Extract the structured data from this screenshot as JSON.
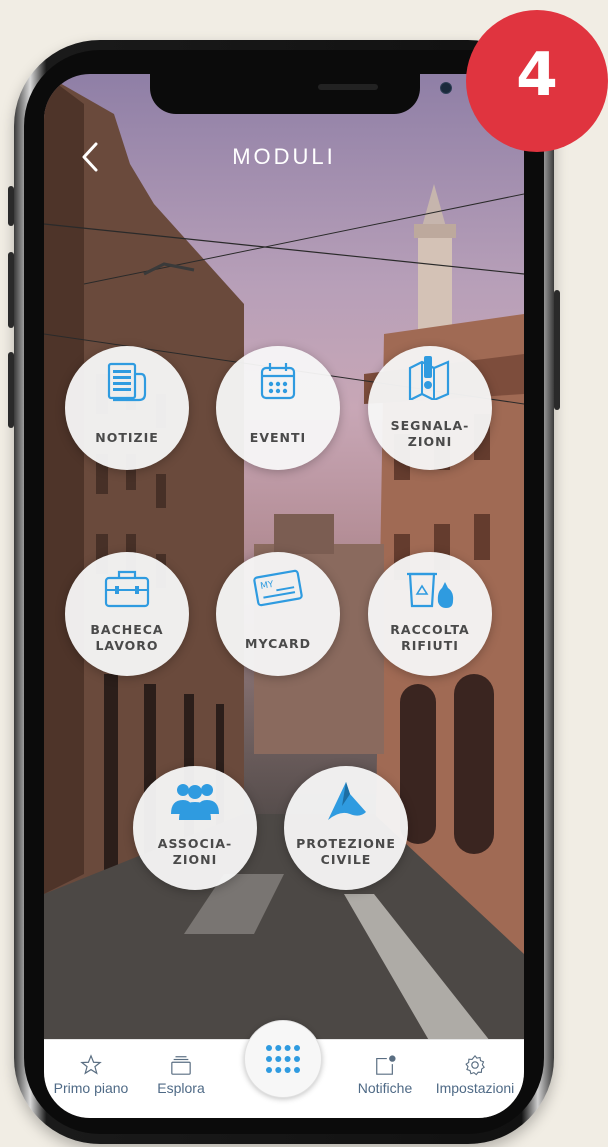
{
  "badge": {
    "number": "4",
    "color": "#e0343f"
  },
  "header": {
    "title": "MODULI",
    "back_icon": "chevron-left-icon"
  },
  "modules": [
    {
      "label": "NOTIZIE",
      "icon": "newspaper-icon"
    },
    {
      "label": "EVENTI",
      "icon": "calendar-icon"
    },
    {
      "label": "SEGNALA-\nZIONI",
      "icon": "map-alert-icon"
    },
    {
      "label": "BACHECA\nLAVORO",
      "icon": "briefcase-icon"
    },
    {
      "label": "MYCARD",
      "icon": "card-icon"
    },
    {
      "label": "RACCOLTA\nRIFIUTI",
      "icon": "recycle-bin-icon"
    },
    {
      "label": "ASSOCIA-\nZIONI",
      "icon": "group-icon"
    },
    {
      "label": "PROTEZIONE\nCIVILE",
      "icon": "civil-protection-icon"
    }
  ],
  "tabbar": {
    "tabs": [
      {
        "label": "Primo piano",
        "icon": "star-icon"
      },
      {
        "label": "Esplora",
        "icon": "layers-icon"
      },
      {
        "label": "Notifiche",
        "icon": "notification-icon"
      },
      {
        "label": "Impostazioni",
        "icon": "gear-icon"
      }
    ],
    "center_icon": "grid-dots-icon"
  },
  "colors": {
    "accent": "#2f9be0",
    "label": "#4a4a4a",
    "tab_text": "#4f6a86"
  }
}
